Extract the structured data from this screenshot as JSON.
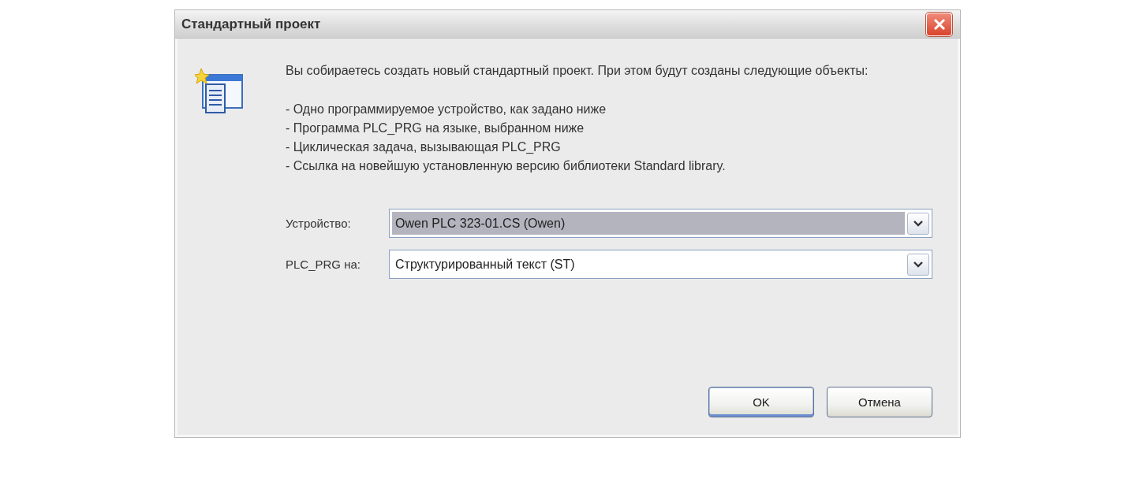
{
  "window": {
    "title": "Стандартный проект"
  },
  "intro": "Вы собираетесь создать новый стандартный проект. При этом будут созданы следующие объекты:",
  "items": [
    "- Одно программируемое устройство, как задано ниже",
    "- Программа PLC_PRG на языке, выбранном ниже",
    "- Циклическая задача, вызывающая PLC_PRG",
    "- Ссылка на новейшую установленную версию библиотеки Standard library."
  ],
  "fields": [
    {
      "label": "Устройство:",
      "value": "Owen PLC 323-01.CS (Owen)",
      "selected": true
    },
    {
      "label": "PLC_PRG на:",
      "value": "Структурированный текст (ST)",
      "selected": false
    }
  ],
  "buttons": [
    {
      "label": "OK",
      "default": true
    },
    {
      "label": "Отмена",
      "default": false
    }
  ]
}
